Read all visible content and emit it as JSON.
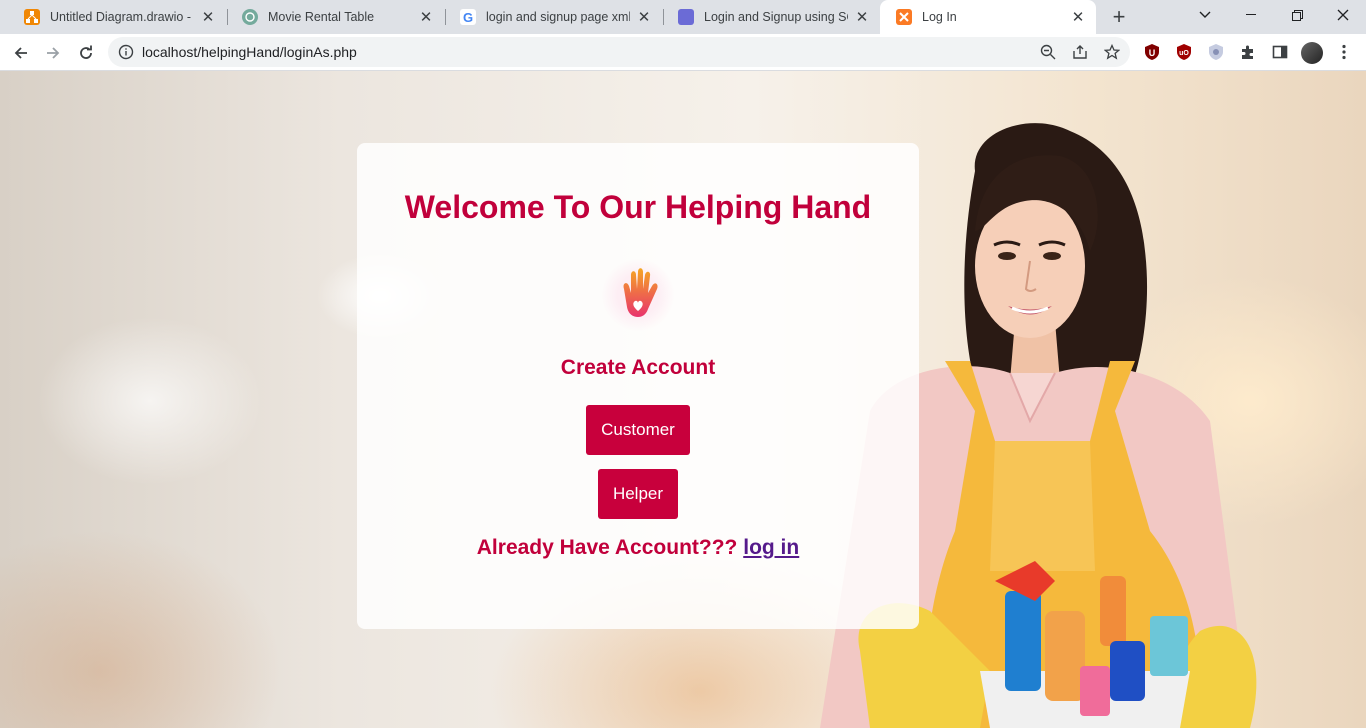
{
  "browser": {
    "tabs": [
      {
        "title": "Untitled Diagram.drawio - dra",
        "favicon": "drawio-icon",
        "color": "#f08705",
        "active": false
      },
      {
        "title": "Movie Rental Table",
        "favicon": "chatgpt-icon",
        "color": "#74aa9c",
        "active": false
      },
      {
        "title": "login and signup page xml and",
        "favicon": "google-icon",
        "color": "#4285f4",
        "active": false
      },
      {
        "title": "Login and Signup using SQLite",
        "favicon": "site-icon",
        "color": "#6b6bd6",
        "active": false
      },
      {
        "title": "Log In",
        "favicon": "xampp-icon",
        "color": "#fb7a24",
        "active": true
      }
    ],
    "url": "localhost/helpingHand/loginAs.php"
  },
  "page": {
    "title": "Welcome To Our Helping Hand",
    "subtitle": "Create Account",
    "customer_button": "Customer",
    "helper_button": "Helper",
    "already_text": "Already Have Account???",
    "login_link": "log in"
  },
  "colors": {
    "accent": "#c8003c",
    "link": "#551a8b"
  }
}
